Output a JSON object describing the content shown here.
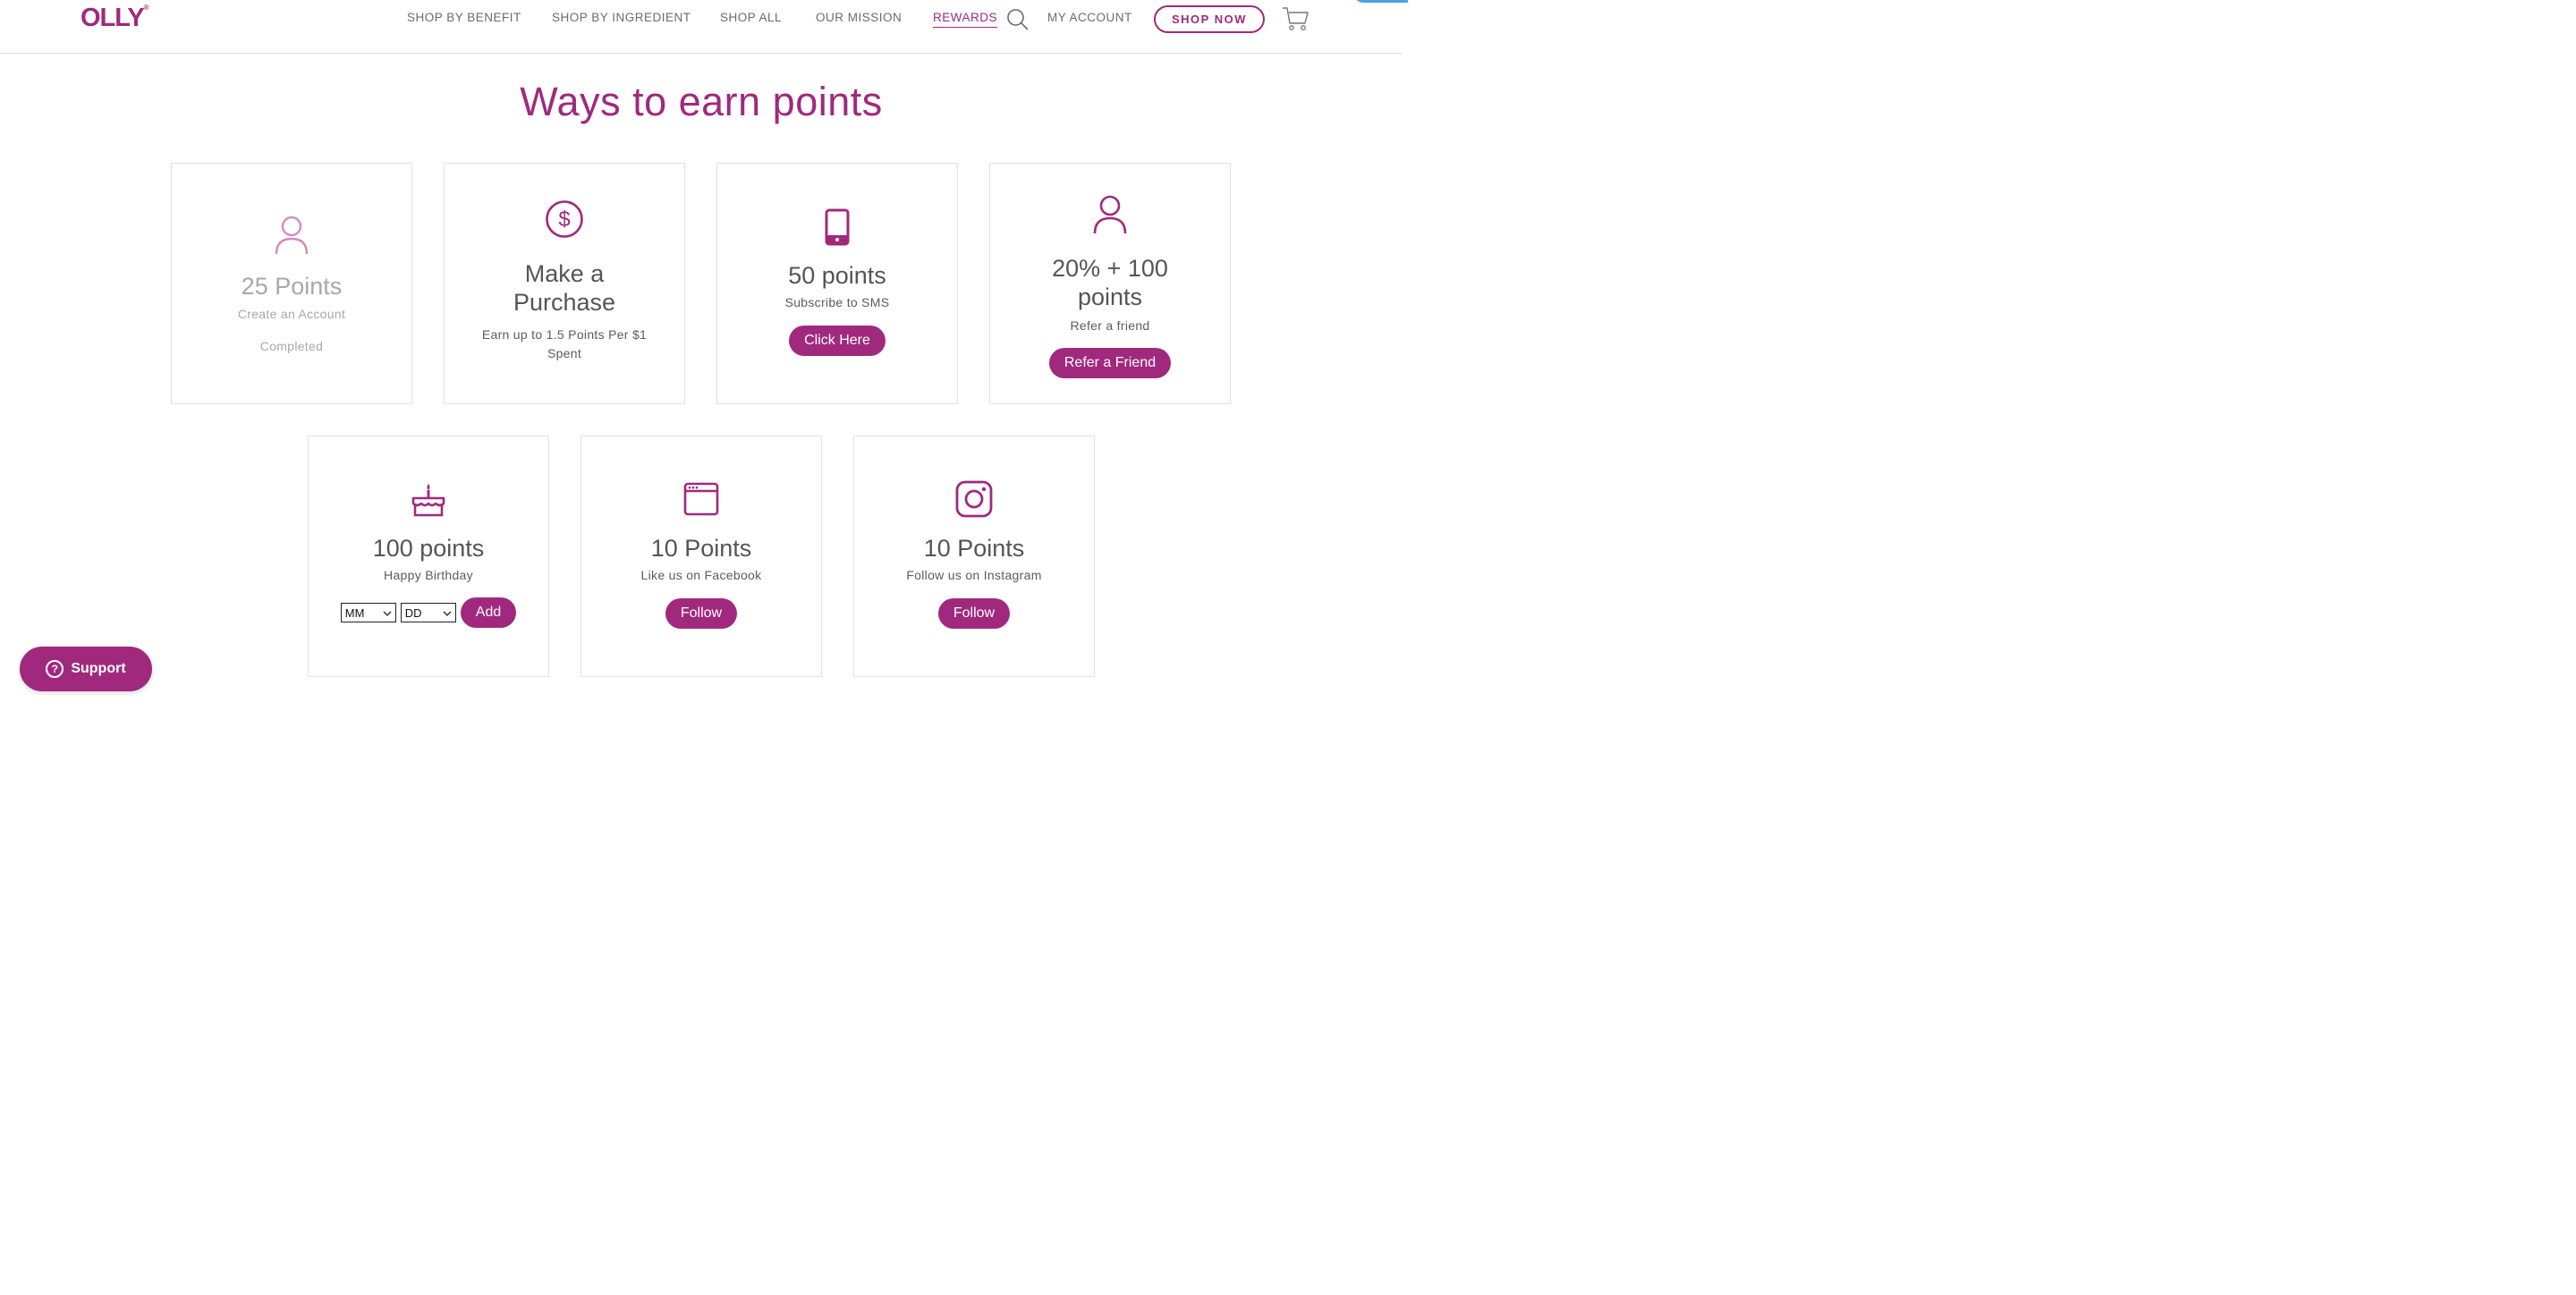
{
  "header": {
    "logo": "OLLY",
    "logo_mark": "®",
    "nav": [
      {
        "label": "SHOP BY BENEFIT"
      },
      {
        "label": "SHOP BY INGREDIENT"
      },
      {
        "label": "SHOP ALL"
      },
      {
        "label": "OUR MISSION"
      },
      {
        "label": "REWARDS"
      },
      {
        "label": "MY ACCOUNT"
      }
    ],
    "shop_now": "SHOP NOW",
    "search_icon": "search-icon",
    "cart_icon": "cart-icon"
  },
  "page": {
    "title": "Ways to earn points"
  },
  "cards": [
    {
      "icon": "user-icon",
      "points": "25 Points",
      "desc": "Create an Account",
      "status": "Completed"
    },
    {
      "icon": "dollar-icon",
      "points_line1": "Make a",
      "points_line2": "Purchase",
      "desc_line1": "Earn up to 1.5 Points Per $1",
      "desc_line2": "Spent"
    },
    {
      "icon": "phone-icon",
      "points": "50 points",
      "desc": "Subscribe to SMS",
      "button": "Click Here"
    },
    {
      "icon": "user-icon",
      "points_line1": "20% + 100",
      "points_line2": "points",
      "desc": "Refer a friend",
      "button": "Refer a Friend"
    },
    {
      "icon": "cake-icon",
      "points": "100 points",
      "desc": "Happy Birthday",
      "month_select": "MM",
      "day_select": "DD",
      "button": "Add"
    },
    {
      "icon": "browser-icon",
      "points": "10 Points",
      "desc": "Like us on Facebook",
      "button": "Follow"
    },
    {
      "icon": "instagram-icon",
      "points": "10 Points",
      "desc": "Follow us on Instagram",
      "button": "Follow"
    }
  ],
  "support": {
    "label": "Support",
    "icon_glyph": "?"
  },
  "colors": {
    "brand": "#a0297e",
    "text": "#555555",
    "muted": "#a8a8a8"
  }
}
